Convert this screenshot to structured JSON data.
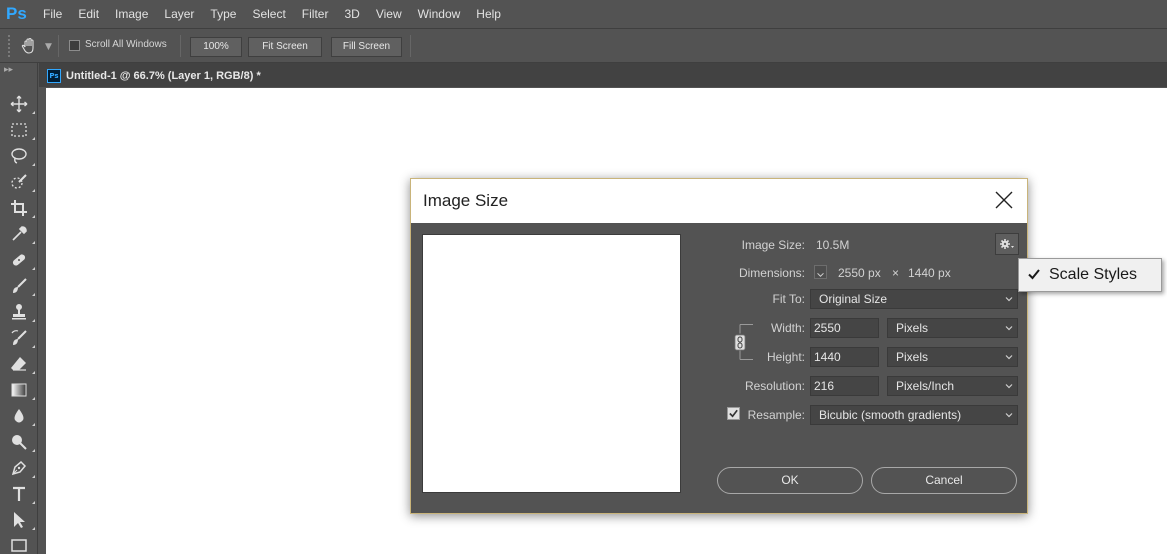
{
  "app": {
    "logo": "Ps"
  },
  "menu": [
    "File",
    "Edit",
    "Image",
    "Layer",
    "Type",
    "Select",
    "Filter",
    "3D",
    "View",
    "Window",
    "Help"
  ],
  "options_bar": {
    "tool_icon": "hand-icon",
    "scroll_all_windows_label": "Scroll All Windows",
    "scroll_all_windows_checked": false,
    "zoom_button": "100%",
    "fit_screen_button": "Fit Screen",
    "fill_screen_button": "Fill Screen"
  },
  "toolbar": {
    "tools": [
      "move-icon",
      "marquee-icon",
      "lasso-icon",
      "quick-select-icon",
      "crop-icon",
      "eyedropper-icon",
      "healing-brush-icon",
      "brush-icon",
      "clone-stamp-icon",
      "history-brush-icon",
      "eraser-icon",
      "gradient-icon",
      "blur-icon",
      "dodge-icon",
      "pen-icon",
      "type-icon",
      "path-select-icon",
      "rectangle-icon"
    ]
  },
  "document": {
    "tab_badge": "Ps",
    "tab_title": "Untitled-1 @ 66.7% (Layer 1, RGB/8) *"
  },
  "dialog": {
    "title": "Image Size",
    "image_size_label": "Image Size:",
    "image_size_value": "10.5M",
    "dimensions_label": "Dimensions:",
    "dimensions_width": "2550 px",
    "dimensions_times": "×",
    "dimensions_height": "1440 px",
    "fit_to_label": "Fit To:",
    "fit_to_value": "Original Size",
    "width_label": "Width:",
    "width_value": "2550",
    "width_unit": "Pixels",
    "height_label": "Height:",
    "height_value": "1440",
    "height_unit": "Pixels",
    "resolution_label": "Resolution:",
    "resolution_value": "216",
    "resolution_unit": "Pixels/Inch",
    "resample_label": "Resample:",
    "resample_checked": true,
    "resample_value": "Bicubic (smooth gradients)",
    "ok_button": "OK",
    "cancel_button": "Cancel"
  },
  "popup_menu": {
    "items": [
      {
        "label": "Scale Styles",
        "checked": true
      }
    ]
  },
  "colors": {
    "ui_bg": "#535353",
    "tab_bg": "#424242",
    "ps_blue": "#31a8ff",
    "dialog_border": "#c9b47a"
  }
}
